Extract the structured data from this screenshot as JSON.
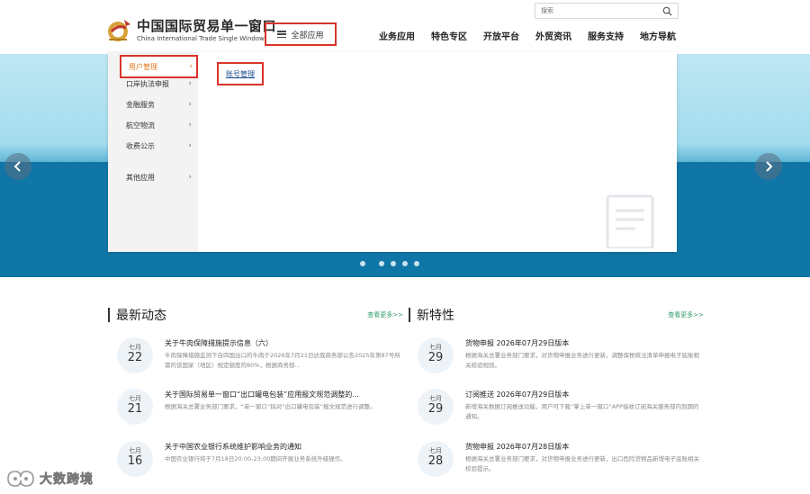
{
  "header": {
    "logo_cn": "中国国际贸易单一窗口",
    "logo_en": "China International Trade Single Window",
    "all_apps_label": "全部应用",
    "search_placeholder": "搜索"
  },
  "nav": [
    {
      "label": "业务应用"
    },
    {
      "label": "特色专区"
    },
    {
      "label": "开放平台"
    },
    {
      "label": "外贸资讯"
    },
    {
      "label": "服务支持"
    },
    {
      "label": "地方导航"
    }
  ],
  "menu": {
    "categories": [
      {
        "label": "用户管理",
        "active": true
      },
      {
        "label": "口岸执法申报"
      },
      {
        "label": "金融服务"
      },
      {
        "label": "航空物流"
      },
      {
        "label": "收费公示"
      },
      {
        "label": "其他应用"
      }
    ],
    "chevron": "›",
    "sub_items": [
      {
        "label": "账号管理"
      }
    ]
  },
  "banner": {
    "prev_glyph": "‹",
    "next_glyph": "›"
  },
  "sections": {
    "latest": {
      "title": "最新动态",
      "more": "查看更多>>",
      "items": [
        {
          "month": "七月",
          "day": "22",
          "title": "关于牛肉保障措施提示信息（六）",
          "desc": "牛肉保障措施监测下自四国出口的牛肉于2026年7月21日达我商务部公告2025年第87号所需的该国家（地区）规定额度的80%，根据商务部..."
        },
        {
          "month": "七月",
          "day": "21",
          "title": "关于国际贸易单一窗口“出口罐电包装”应用报文规范调整的...",
          "desc": "根据海关总署业务部门要求，“单一窗口”拟对“出口罐电包装”报文规范进行调整。"
        },
        {
          "month": "七月",
          "day": "16",
          "title": "关于中国农业银行系统维护影响业务的通知",
          "desc": "中国农业银行将于7月18日20:00-23:00期间开展业务系统升级操作。"
        }
      ]
    },
    "features": {
      "title": "新特性",
      "more": "查看更多>>",
      "items": [
        {
          "month": "七月",
          "day": "29",
          "title": "货物申报 2026年07月29日版本",
          "desc": "根据海关总署业务部门要求，对货物申报业务进行更新，调整保税核注清单申报电子底账相关校验规则。"
        },
        {
          "month": "七月",
          "day": "29",
          "title": "订阅推送 2026年07月29日版本",
          "desc": "新增海关数据订阅推送功能，用户可下载“掌上单一窗口”APP接收订阅海关服务部内到期的通知。"
        },
        {
          "month": "七月",
          "day": "28",
          "title": "货物申报 2026年07月28日版本",
          "desc": "根据海关总署业务部门要求，对货物申报业务进行更新，出口危险货物品新增电子底账相关校验提示。"
        }
      ]
    }
  },
  "watermark": {
    "text": "大数跨境"
  },
  "colors": {
    "highlight_border": "#d9342b",
    "accent_orange": "#e07a1f",
    "more_link": "#2f9a6b",
    "banner_sea": "#1076a7"
  }
}
